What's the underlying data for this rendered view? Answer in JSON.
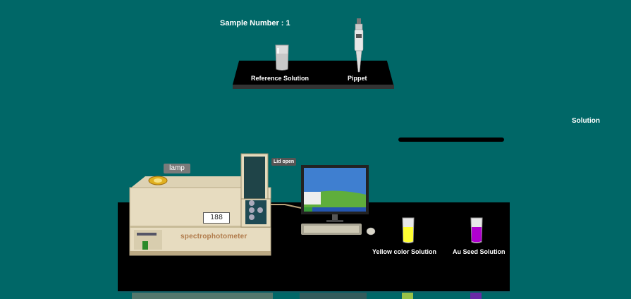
{
  "header": {
    "sample_number": "Sample Number : 1"
  },
  "shelf": {
    "reference_solution_label": "Reference Solution",
    "pippet_label": "Pippet"
  },
  "solution_panel": {
    "label": "Solution"
  },
  "spectrophotometer": {
    "lamp_label": "lamp",
    "lid_label": "Lid open",
    "name_label": "spectrophotometer",
    "display_value": "188"
  },
  "bench": {
    "yellow_solution_label": "Yellow color Solution",
    "au_seed_solution_label": "Au Seed Solution"
  },
  "colors": {
    "background": "#006767",
    "yellow_solution": "#ffff33",
    "au_seed_solution": "#b000d0"
  }
}
